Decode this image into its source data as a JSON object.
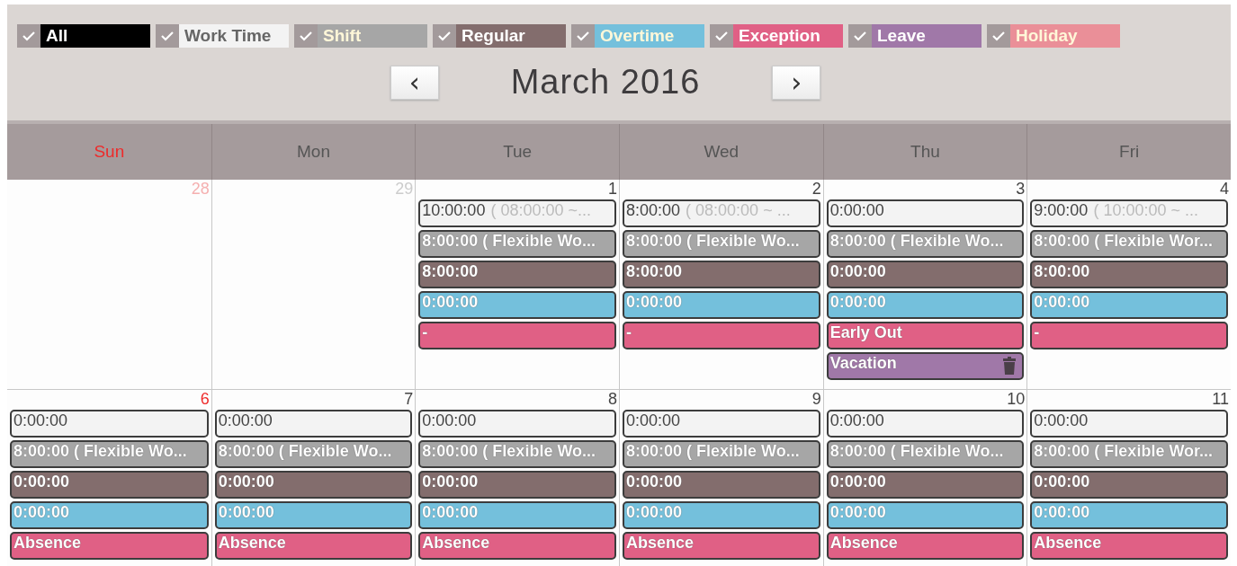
{
  "filters": [
    {
      "label": "All",
      "checked": true,
      "color": "#000000"
    },
    {
      "label": "Work Time",
      "checked": true,
      "color": "#f3f3f3"
    },
    {
      "label": "Shift",
      "checked": true,
      "color": "#a6a6a6"
    },
    {
      "label": "Regular",
      "checked": true,
      "color": "#836d6d"
    },
    {
      "label": "Overtime",
      "checked": true,
      "color": "#74c0dc"
    },
    {
      "label": "Exception",
      "checked": true,
      "color": "#e06085"
    },
    {
      "label": "Leave",
      "checked": true,
      "color": "#a078a8"
    },
    {
      "label": "Holiday",
      "checked": true,
      "color": "#ea8f98"
    }
  ],
  "nav": {
    "prev": "‹",
    "title": "March 2016",
    "next": "›"
  },
  "weekdays": [
    {
      "label": "Sun",
      "weekend": true
    },
    {
      "label": "Mon",
      "weekend": false
    },
    {
      "label": "Tue",
      "weekend": false
    },
    {
      "label": "Wed",
      "weekend": false
    },
    {
      "label": "Thu",
      "weekend": false
    },
    {
      "label": "Fri",
      "weekend": false
    }
  ],
  "weeks": [
    {
      "days": [
        {
          "day": "28",
          "weekend": true,
          "other_month": true
        },
        {
          "day": "29",
          "weekend": false,
          "other_month": true
        },
        {
          "day": "1",
          "weekend": false,
          "other_month": false,
          "events": [
            {
              "kind": "worktime",
              "time": "10:00:00",
              "detail": "( 08:00:00 ~..."
            },
            {
              "kind": "shift",
              "time": "8:00:00 ( Flexible Wo..."
            },
            {
              "kind": "regular",
              "time": "8:00:00"
            },
            {
              "kind": "overtime",
              "time": "0:00:00"
            },
            {
              "kind": "exception",
              "time": "-"
            }
          ]
        },
        {
          "day": "2",
          "weekend": false,
          "other_month": false,
          "events": [
            {
              "kind": "worktime",
              "time": "8:00:00",
              "detail": "( 08:00:00 ~ ..."
            },
            {
              "kind": "shift",
              "time": "8:00:00 ( Flexible Wo..."
            },
            {
              "kind": "regular",
              "time": "8:00:00"
            },
            {
              "kind": "overtime",
              "time": "0:00:00"
            },
            {
              "kind": "exception",
              "time": "-"
            }
          ]
        },
        {
          "day": "3",
          "weekend": false,
          "other_month": false,
          "events": [
            {
              "kind": "worktime",
              "time": "0:00:00"
            },
            {
              "kind": "shift",
              "time": "8:00:00 ( Flexible Wo..."
            },
            {
              "kind": "regular",
              "time": "0:00:00"
            },
            {
              "kind": "overtime",
              "time": "0:00:00"
            },
            {
              "kind": "exception",
              "time": "Early Out"
            },
            {
              "kind": "leave",
              "time": "Vacation"
            }
          ]
        },
        {
          "day": "4",
          "weekend": false,
          "other_month": false,
          "events": [
            {
              "kind": "worktime",
              "time": "9:00:00",
              "detail": "( 10:00:00 ~ ..."
            },
            {
              "kind": "shift",
              "time": "8:00:00 ( Flexible Wor..."
            },
            {
              "kind": "regular",
              "time": "8:00:00"
            },
            {
              "kind": "overtime",
              "time": "0:00:00"
            },
            {
              "kind": "exception",
              "time": "-"
            }
          ]
        }
      ]
    },
    {
      "days": [
        {
          "day": "6",
          "weekend": true,
          "other_month": false,
          "events": [
            {
              "kind": "worktime",
              "time": "0:00:00"
            },
            {
              "kind": "shift",
              "time": "8:00:00 ( Flexible Wo..."
            },
            {
              "kind": "regular",
              "time": "0:00:00"
            },
            {
              "kind": "overtime",
              "time": "0:00:00"
            },
            {
              "kind": "exception",
              "time": "Absence"
            }
          ]
        },
        {
          "day": "7",
          "weekend": false,
          "other_month": false,
          "events": [
            {
              "kind": "worktime",
              "time": "0:00:00"
            },
            {
              "kind": "shift",
              "time": "8:00:00 ( Flexible Wo..."
            },
            {
              "kind": "regular",
              "time": "0:00:00"
            },
            {
              "kind": "overtime",
              "time": "0:00:00"
            },
            {
              "kind": "exception",
              "time": "Absence"
            }
          ]
        },
        {
          "day": "8",
          "weekend": false,
          "other_month": false,
          "events": [
            {
              "kind": "worktime",
              "time": "0:00:00"
            },
            {
              "kind": "shift",
              "time": "8:00:00 ( Flexible Wo..."
            },
            {
              "kind": "regular",
              "time": "0:00:00"
            },
            {
              "kind": "overtime",
              "time": "0:00:00"
            },
            {
              "kind": "exception",
              "time": "Absence"
            }
          ]
        },
        {
          "day": "9",
          "weekend": false,
          "other_month": false,
          "events": [
            {
              "kind": "worktime",
              "time": "0:00:00"
            },
            {
              "kind": "shift",
              "time": "8:00:00 ( Flexible Wo..."
            },
            {
              "kind": "regular",
              "time": "0:00:00"
            },
            {
              "kind": "overtime",
              "time": "0:00:00"
            },
            {
              "kind": "exception",
              "time": "Absence"
            }
          ]
        },
        {
          "day": "10",
          "weekend": false,
          "other_month": false,
          "events": [
            {
              "kind": "worktime",
              "time": "0:00:00"
            },
            {
              "kind": "shift",
              "time": "8:00:00 ( Flexible Wo..."
            },
            {
              "kind": "regular",
              "time": "0:00:00"
            },
            {
              "kind": "overtime",
              "time": "0:00:00"
            },
            {
              "kind": "exception",
              "time": "Absence"
            }
          ]
        },
        {
          "day": "11",
          "weekend": false,
          "other_month": false,
          "events": [
            {
              "kind": "worktime",
              "time": "0:00:00"
            },
            {
              "kind": "shift",
              "time": "8:00:00 ( Flexible Wor..."
            },
            {
              "kind": "regular",
              "time": "0:00:00"
            },
            {
              "kind": "overtime",
              "time": "0:00:00"
            },
            {
              "kind": "exception",
              "time": "Absence"
            }
          ]
        }
      ]
    }
  ]
}
